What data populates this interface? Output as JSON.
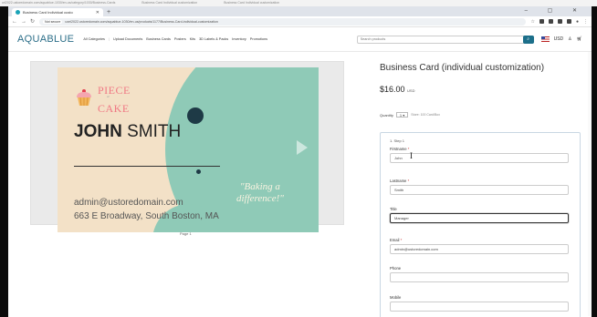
{
  "top_strip": [
    "url2022.ustoredomain.com/aquablue-1030/en-us/category/1030/Business-Cards",
    "Business Card Individual customization",
    "Business Card Individual customization"
  ],
  "browser": {
    "tab_title": "Business Card Individual custo",
    "tab_close": "✕",
    "new_tab": "+",
    "window_controls": "– ▢ ✕",
    "not_secure": "Not secure",
    "url": "uxel2022.ustoredomain.com/aquablue-1030/en-us/products/1177/Business-Card-individual-customization"
  },
  "site": {
    "logo_main": "AQUA",
    "logo_sub": "BLUE",
    "nav": [
      "All Categories",
      "Upload Documents",
      "Business Cards",
      "Posters",
      "Kits",
      "3D Labels & Packs",
      "Inventory",
      "Promotions"
    ],
    "search_placeholder": "Search products",
    "currency": "USD"
  },
  "preview": {
    "brand_top": "PIECE",
    "brand_mid": "of",
    "brand_bottom": "CAKE",
    "name_first": "JOHN",
    "name_last": "SMITH",
    "slogan_line1": "\"Baking a",
    "slogan_line2": "difference!\"",
    "email": "admin@ustoredomain.com",
    "address": "663 E Broadway, South Boston, MA",
    "page_label": "Page 1",
    "colors": {
      "background": "#f3e1c7",
      "blob": "#8fcab7",
      "brand": "#f07884"
    }
  },
  "product": {
    "title": "Business Card (individual customization)",
    "price": "$16.00",
    "price_currency": "USD",
    "quantity_label": "Quantity",
    "quantity_value": "1",
    "quantity_note": "Store: 100 Card/Box"
  },
  "form": {
    "step_label": "1.  Step 1",
    "fields": [
      {
        "label": "Firstname",
        "required": "*",
        "value": "John"
      },
      {
        "label": "Lastname",
        "required": "*",
        "value": "Smith"
      },
      {
        "label": "Title",
        "required": "",
        "value": "Manager"
      },
      {
        "label": "Email",
        "required": "*",
        "value": "admin@ustoredomain.com"
      },
      {
        "label": "Phone",
        "required": "",
        "value": ""
      },
      {
        "label": "Mobile",
        "required": "",
        "value": ""
      }
    ]
  }
}
